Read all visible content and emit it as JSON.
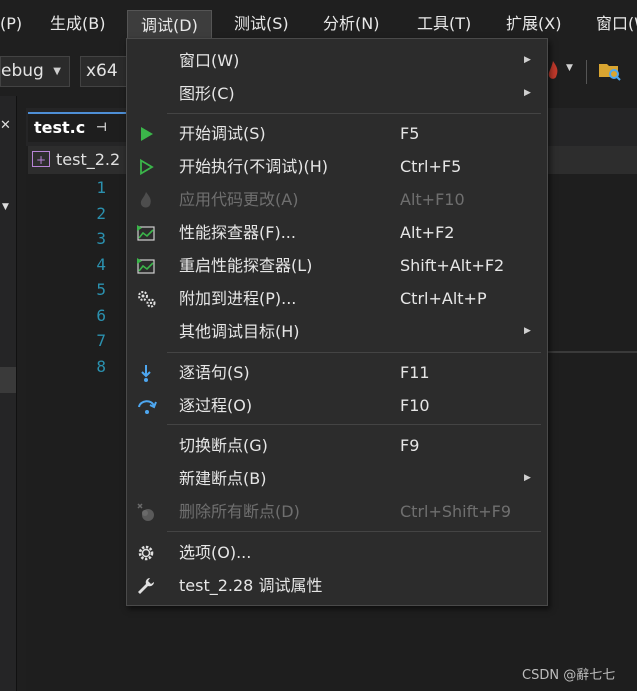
{
  "menubar": {
    "items": [
      "(P)",
      "生成(B)",
      "调试(D)",
      "测试(S)",
      "分析(N)",
      "工具(T)",
      "扩展(X)",
      "窗口(W"
    ]
  },
  "toolbar": {
    "config": "ebug",
    "platform": "x64"
  },
  "editor": {
    "tab": "test.c",
    "tab_pin": "⊣",
    "nav_file": "test_2.2",
    "line_numbers": [
      "1",
      "2",
      "3",
      "4",
      "5",
      "6",
      "7",
      "8"
    ]
  },
  "debug_menu": {
    "items": [
      {
        "label": "窗口(W)",
        "shortcut": "",
        "submenu": true,
        "icon": "none"
      },
      {
        "label": "图形(C)",
        "shortcut": "",
        "submenu": true,
        "icon": "none"
      },
      {
        "label": "开始调试(S)",
        "shortcut": "F5",
        "icon": "play-filled-icon"
      },
      {
        "label": "开始执行(不调试)(H)",
        "shortcut": "Ctrl+F5",
        "icon": "play-outline-icon"
      },
      {
        "label": "应用代码更改(A)",
        "shortcut": "Alt+F10",
        "icon": "hot-reload-icon",
        "disabled": true
      },
      {
        "label": "性能探查器(F)...",
        "shortcut": "Alt+F2",
        "icon": "profiler-icon"
      },
      {
        "label": "重启性能探查器(L)",
        "shortcut": "Shift+Alt+F2",
        "icon": "profiler-restart-icon"
      },
      {
        "label": "附加到进程(P)...",
        "shortcut": "Ctrl+Alt+P",
        "icon": "gears-icon"
      },
      {
        "label": "其他调试目标(H)",
        "shortcut": "",
        "submenu": true,
        "icon": "none"
      },
      {
        "label": "逐语句(S)",
        "shortcut": "F11",
        "icon": "step-into-icon"
      },
      {
        "label": "逐过程(O)",
        "shortcut": "F10",
        "icon": "step-over-icon"
      },
      {
        "label": "切换断点(G)",
        "shortcut": "F9",
        "icon": "none"
      },
      {
        "label": "新建断点(B)",
        "shortcut": "",
        "submenu": true,
        "icon": "none"
      },
      {
        "label": "删除所有断点(D)",
        "shortcut": "Ctrl+Shift+F9",
        "icon": "delete-breakpoints-icon",
        "disabled": true
      },
      {
        "label": "选项(O)...",
        "shortcut": "",
        "icon": "gear-icon"
      },
      {
        "label": "test_2.28 调试属性",
        "shortcut": "",
        "icon": "wrench-icon"
      }
    ],
    "submenu_arrow": "▶"
  },
  "watermark": "CSDN @辭七七",
  "colors": {
    "accent_green": "#3bb54a",
    "accent_blue": "#4ea7f0",
    "menu_bg": "#2c2c2c",
    "disabled_text": "#6f6f6f"
  }
}
